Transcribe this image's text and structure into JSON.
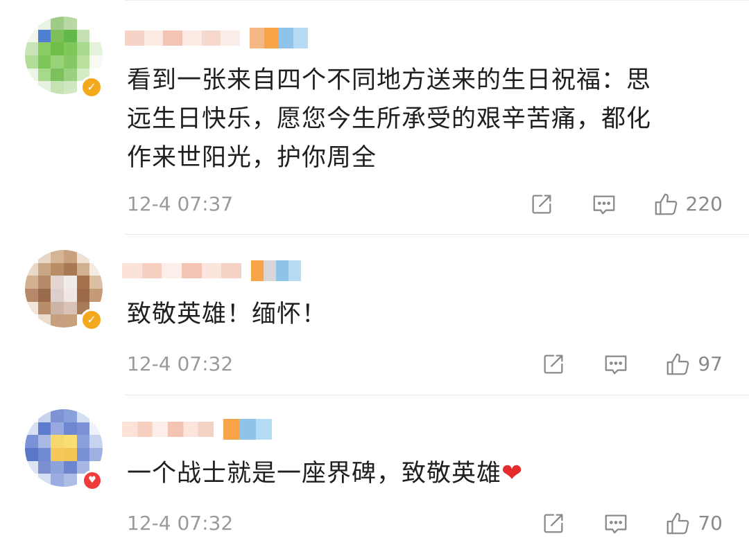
{
  "comments": [
    {
      "text_lines": [
        "看到一张来自四个不同地方送来的生日祝福：思",
        "远生日快乐，愿您今生所承受的艰辛苦痛，都化",
        "作来世阳光，护你周全"
      ],
      "time": "12-4 07:37",
      "likes": "220",
      "avatar_colors": [
        "#ffffff",
        "#e8f3e2",
        "#9ecb85",
        "#b8d8a4",
        "#ffffff",
        "#ffffff",
        "#f1f7ec",
        "#4f7fd0",
        "#7dc05a",
        "#63b84a",
        "#c4e0b3",
        "#ffffff",
        "#c9e5b8",
        "#8bcc63",
        "#6fbe49",
        "#7fc75b",
        "#a6d98b",
        "#e5f2dc",
        "#b2dd99",
        "#7dc659",
        "#98d279",
        "#86c964",
        "#b9df9f",
        "#f7fbf3",
        "#ecf6e5",
        "#a6d98a",
        "#7dc15d",
        "#9bd07e",
        "#d4ebc6",
        "#ffffff",
        "#ffffff",
        "#e6f2de",
        "#c5e3b2",
        "#cfe8c1",
        "#ffffff",
        "#ffffff"
      ],
      "badge": "verified",
      "name_blur": [
        "#f6d3c6",
        "#fbe9e2",
        "#f3c3b4",
        "#fde9e3",
        "#f6d8cd",
        "#fbeee8"
      ],
      "badge_blur": [
        "#f3b783",
        "#f7a449",
        "#8fc3ea",
        "#b6dbf5"
      ]
    },
    {
      "text_lines": [
        "致敬英雄！缅怀！"
      ],
      "time": "12-4 07:32",
      "likes": "97",
      "avatar_colors": [
        "#ffffff",
        "#e8d7c6",
        "#d6b596",
        "#c9a17f",
        "#efe2d5",
        "#ffffff",
        "#ead8c6",
        "#c9a684",
        "#b98d68",
        "#a77954",
        "#d1b190",
        "#f4ebe2",
        "#d3b08f",
        "#b48a68",
        "#e3d5cf",
        "#f1ece8",
        "#a6704c",
        "#d9bfa3",
        "#b7896a",
        "#9a6c4c",
        "#ddcfcb",
        "#efe7e3",
        "#9c6a48",
        "#c59b77",
        "#f1e5d9",
        "#b88d6b",
        "#cdb4a6",
        "#d8c3b6",
        "#a87a56",
        "#ffffff",
        "#ffffff",
        "#ecdccd",
        "#c79f7e",
        "#c9a07d",
        "#ffffff",
        "#ffffff"
      ],
      "badge": "verified",
      "name_blur": [
        "#fbe3d9",
        "#f6cfc0",
        "#fceee8",
        "#f3c4b4",
        "#fbe5dc",
        "#f6d2c4"
      ],
      "badge_blur": [
        "#f7a449",
        "#d9d5d9",
        "#8fc3ea",
        "#b6dbf5"
      ]
    },
    {
      "text_lines": [
        "一个战士就是一座界碑，致敬英雄"
      ],
      "heart": "❤",
      "time": "12-4 07:32",
      "likes": "70",
      "avatar_colors": [
        "#ffffff",
        "#c7d3ee",
        "#7f93d4",
        "#8aa0db",
        "#d4def3",
        "#ffffff",
        "#d8e1f4",
        "#5e7ccd",
        "#97a9de",
        "#6d87d1",
        "#7d92d6",
        "#eef2fa",
        "#7b93d6",
        "#a9b9e4",
        "#f6d76b",
        "#f9df73",
        "#8ba0da",
        "#c7d2ee",
        "#5976c7",
        "#6f8ad3",
        "#f4c95a",
        "#f2c654",
        "#7a92d5",
        "#9eb0e0",
        "#dbe3f5",
        "#7b8fd1",
        "#8ea3dc",
        "#6d84cf",
        "#a7b6e2",
        "#ffffff",
        "#ffffff",
        "#d7dff3",
        "#9aace0",
        "#aebde6",
        "#ffffff",
        "#ffffff"
      ],
      "badge": "heart",
      "name_blur": [
        "#fbe3d9",
        "#f6cfc0",
        "#fceee8",
        "#f3c4b4",
        "#fbe5dc",
        "#f6d2c4"
      ],
      "badge_blur": [
        "#f7a449",
        "#8fc3ea",
        "#b6dbf5"
      ]
    }
  ],
  "icons": {
    "share": "share-icon",
    "reply": "comment-icon",
    "like": "thumbs-up-icon"
  }
}
